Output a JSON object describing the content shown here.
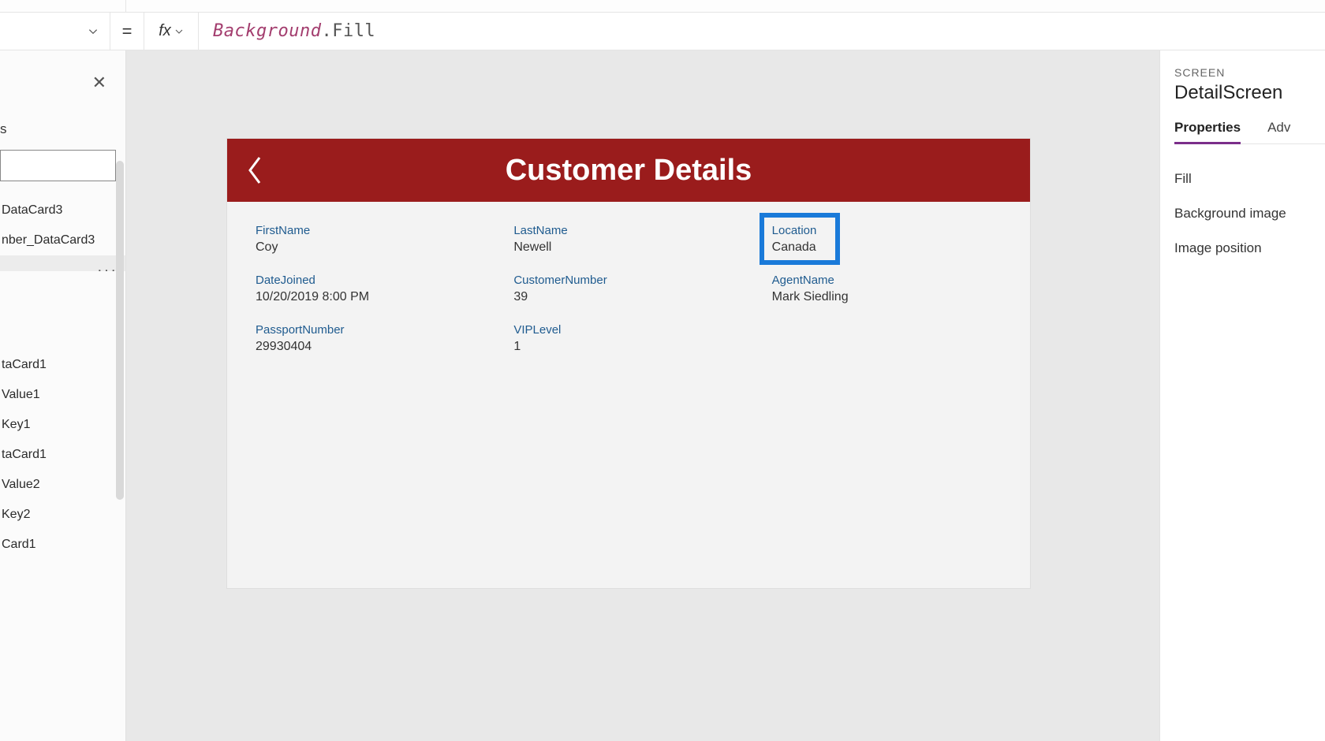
{
  "formula_bar": {
    "fx_label": "fx",
    "equals": "=",
    "token1": "Background",
    "token2": ".Fill"
  },
  "tree": {
    "header_suffix": "s",
    "items": [
      "DataCard3",
      "nber_DataCard3",
      "",
      "taCard1",
      "Value1",
      "Key1",
      "taCard1",
      "Value2",
      "Key2",
      "Card1"
    ]
  },
  "app": {
    "title": "Customer Details",
    "cards": [
      {
        "label": "FirstName",
        "value": "Coy"
      },
      {
        "label": "LastName",
        "value": "Newell"
      },
      {
        "label": "Location",
        "value": "Canada"
      },
      {
        "label": "DateJoined",
        "value": "10/20/2019 8:00 PM"
      },
      {
        "label": "CustomerNumber",
        "value": "39"
      },
      {
        "label": "AgentName",
        "value": "Mark Siedling"
      },
      {
        "label": "PassportNumber",
        "value": "29930404"
      },
      {
        "label": "VIPLevel",
        "value": "1"
      }
    ]
  },
  "right_panel": {
    "kicker": "SCREEN",
    "title": "DetailScreen",
    "tabs": {
      "properties": "Properties",
      "advanced": "Adv"
    },
    "props": [
      "Fill",
      "Background image",
      "Image position"
    ]
  }
}
